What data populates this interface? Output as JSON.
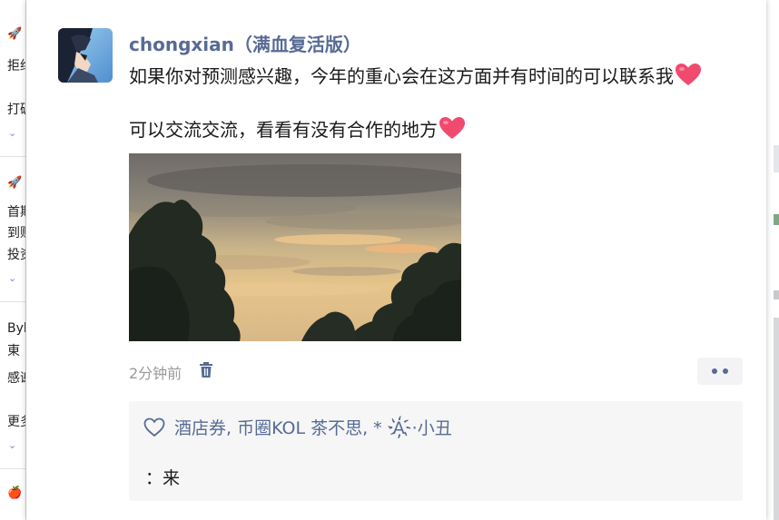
{
  "background": {
    "left_fragments": [
      "拒绝",
      "打破",
      "首期",
      "到账",
      "投资",
      "Byb",
      "東",
      "感谢",
      "更多"
    ]
  },
  "post": {
    "username": "chongxian（满血复活版）",
    "text_line1": "如果你对预测感兴趣，今年的重心会在这方面并有时间的可以联系我",
    "text_line2": "可以交流交流，看看有没有合作的地方",
    "time": "2分钟前",
    "icons": {
      "heart": "heart-emoji-icon",
      "trash": "trash-icon",
      "like": "heart-outline-icon",
      "more": "more-dots-icon"
    }
  },
  "interactions": {
    "likes": "酒店券, 币圈KOL 茶不思, *  ·A҉·小丑",
    "comment": "：来"
  },
  "colors": {
    "username": "#576b95",
    "heart": "#f04a6e",
    "panel": "#f6f6f6"
  }
}
